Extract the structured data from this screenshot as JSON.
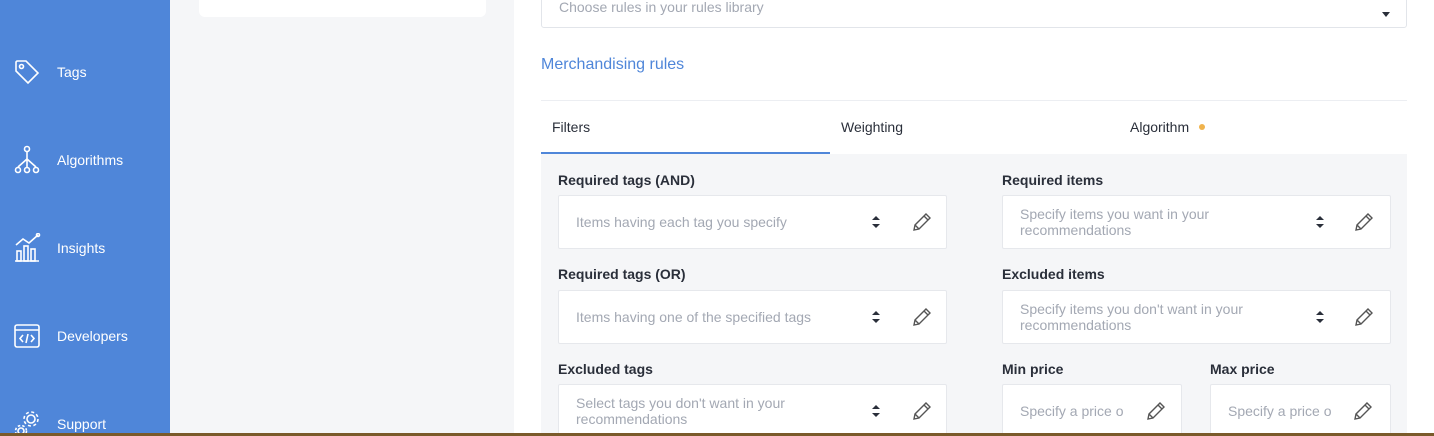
{
  "sidebar": {
    "items": [
      {
        "label": "Tags",
        "icon": "tag-icon"
      },
      {
        "label": "Algorithms",
        "icon": "algorithm-tree-icon"
      },
      {
        "label": "Insights",
        "icon": "chart-icon"
      },
      {
        "label": "Developers",
        "icon": "code-window-icon"
      },
      {
        "label": "Support",
        "icon": "gears-icon"
      }
    ]
  },
  "rules_select": {
    "placeholder": "Choose rules in your rules library"
  },
  "section_title": "Merchandising rules",
  "tabs": [
    {
      "label": "Filters",
      "active": true
    },
    {
      "label": "Weighting",
      "active": false
    },
    {
      "label": "Algorithm",
      "active": false,
      "dot_color": "#f0b34d"
    }
  ],
  "filters": {
    "required_tags_and": {
      "label": "Required tags (AND)",
      "placeholder": "Items having each tag you specify"
    },
    "required_items": {
      "label": "Required items",
      "placeholder": "Specify items you want in your recommendations"
    },
    "required_tags_or": {
      "label": "Required tags (OR)",
      "placeholder": "Items having one of the specified tags"
    },
    "excluded_items": {
      "label": "Excluded items",
      "placeholder": "Specify items you don't want in your recommendations"
    },
    "excluded_tags": {
      "label": "Excluded tags",
      "placeholder": "Select tags you don't want in your recommendations"
    },
    "min_price": {
      "label": "Min price",
      "placeholder": "Specify a price or"
    },
    "max_price": {
      "label": "Max price",
      "placeholder": "Specify a price or"
    }
  },
  "colors": {
    "accent": "#4f86d9",
    "sidebar": "#4f86d9",
    "panel": "#f5f6f8",
    "dot": "#f0b34d"
  }
}
